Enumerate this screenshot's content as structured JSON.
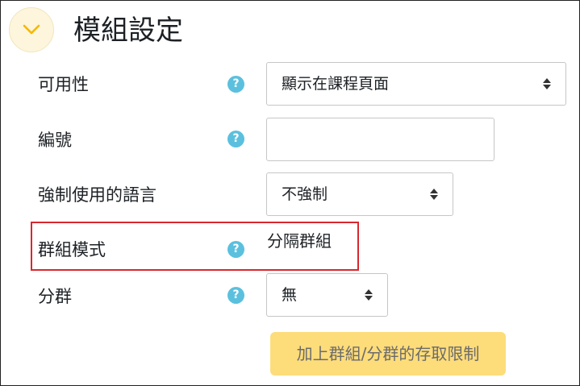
{
  "section": {
    "title": "模組設定",
    "collapse_icon": "chevron-down-icon"
  },
  "fields": {
    "availability": {
      "label": "可用性",
      "value": "顯示在課程頁面"
    },
    "idnumber": {
      "label": "編號",
      "value": ""
    },
    "force_language": {
      "label": "強制使用的語言",
      "value": "不強制"
    },
    "group_mode": {
      "label": "群組模式",
      "value": "分隔群組"
    },
    "grouping": {
      "label": "分群",
      "value": "無"
    }
  },
  "help_icon_glyph": "?",
  "buttons": {
    "add_restriction": "加上群組/分群的存取限制"
  },
  "colors": {
    "help_icon": "#5bc0de",
    "collapse_bg": "#fdf5dc",
    "chevron": "#f5b800",
    "highlight_border": "#d9272e",
    "button_bg": "#fddc7a"
  }
}
